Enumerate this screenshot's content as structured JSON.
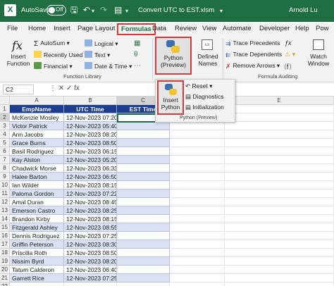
{
  "titlebar": {
    "app_logo": "X",
    "autosave_label": "AutoSave",
    "autosave_state": "Off",
    "filename": "Convert UTC to EST.xlsm",
    "user": "Arnold Lu",
    "brand_color": "#1e6e42"
  },
  "tabs": [
    "File",
    "Home",
    "Insert",
    "Page Layout",
    "Formulas",
    "Data",
    "Review",
    "View",
    "Automate",
    "Developer",
    "Help",
    "Pow"
  ],
  "active_tab": "Formulas",
  "ribbon": {
    "insert_function": "Insert\nFunction",
    "autosum": "AutoSum",
    "recently_used": "Recently Used",
    "financial": "Financial",
    "logical": "Logical",
    "text": "Text",
    "date_time": "Date & Time",
    "function_library": "Function Library",
    "python_preview": "Python\n(Preview)",
    "defined_names": "Defined\nNames",
    "trace_precedents": "Trace Precedents",
    "trace_dependents": "Trace Dependents",
    "remove_arrows": "Remove Arrows",
    "watch_window": "Watch\nWindow",
    "formula_auditing": "Formula Auditing",
    "fx_symbol": "fx"
  },
  "formula_bar": {
    "name_box": "C2",
    "icons": "⋮  ✕  ✓  fx"
  },
  "python_popup": {
    "insert_python": "Insert\nPython",
    "reset": "Reset",
    "diagnostics": "Diagnostics",
    "initialization": "Initialization",
    "group_label": "Python (Preview)"
  },
  "grid": {
    "columns": [
      "A",
      "B",
      "C",
      "D",
      "E"
    ],
    "headers": [
      "EmpName",
      "UTC Time",
      "EST Time"
    ],
    "rows": [
      [
        "McKenzie Mosley",
        "12-Nov-2023 07:20"
      ],
      [
        "Victor Patrick",
        "12-Nov-2023 05:40"
      ],
      [
        "Ann Jacobs",
        "12-Nov-2023 08:20"
      ],
      [
        "Grace Burns",
        "12-Nov-2023 08:50"
      ],
      [
        "Basil Rodriguez",
        "12-Nov-2023 06:15"
      ],
      [
        "Kay Alston",
        "12-Nov-2023 05:20"
      ],
      [
        "Chadwick Morse",
        "12-Nov-2023 06:33"
      ],
      [
        "Halee Barton",
        "12-Nov-2023 06:50"
      ],
      [
        "Ian Wilder",
        "12-Nov-2023 08:15"
      ],
      [
        "Paloma Gordon",
        "12-Nov-2023 07:22"
      ],
      [
        "Amal Duran",
        "12-Nov-2023 08:45"
      ],
      [
        "Emerson Castro",
        "12-Nov-2023 08:25"
      ],
      [
        "Brandon Kirby",
        "12-Nov-2023 08:15"
      ],
      [
        "Fitzgerald Ashley",
        "12-Nov-2023 08:55"
      ],
      [
        "Dennis Rodriguez",
        "12-Nov-2023 07:25"
      ],
      [
        "Griffin Peterson",
        "12-Nov-2023 08:30"
      ],
      [
        "Priscilla Roth",
        "12-Nov-2023 08:50"
      ],
      [
        "Nissim Byrd",
        "12-Nov-2023 08:20"
      ],
      [
        "Tatum Calderon",
        "12-Nov-2023 06:40"
      ],
      [
        "Garrett Rice",
        "12-Nov-2023 07:25"
      ]
    ]
  }
}
